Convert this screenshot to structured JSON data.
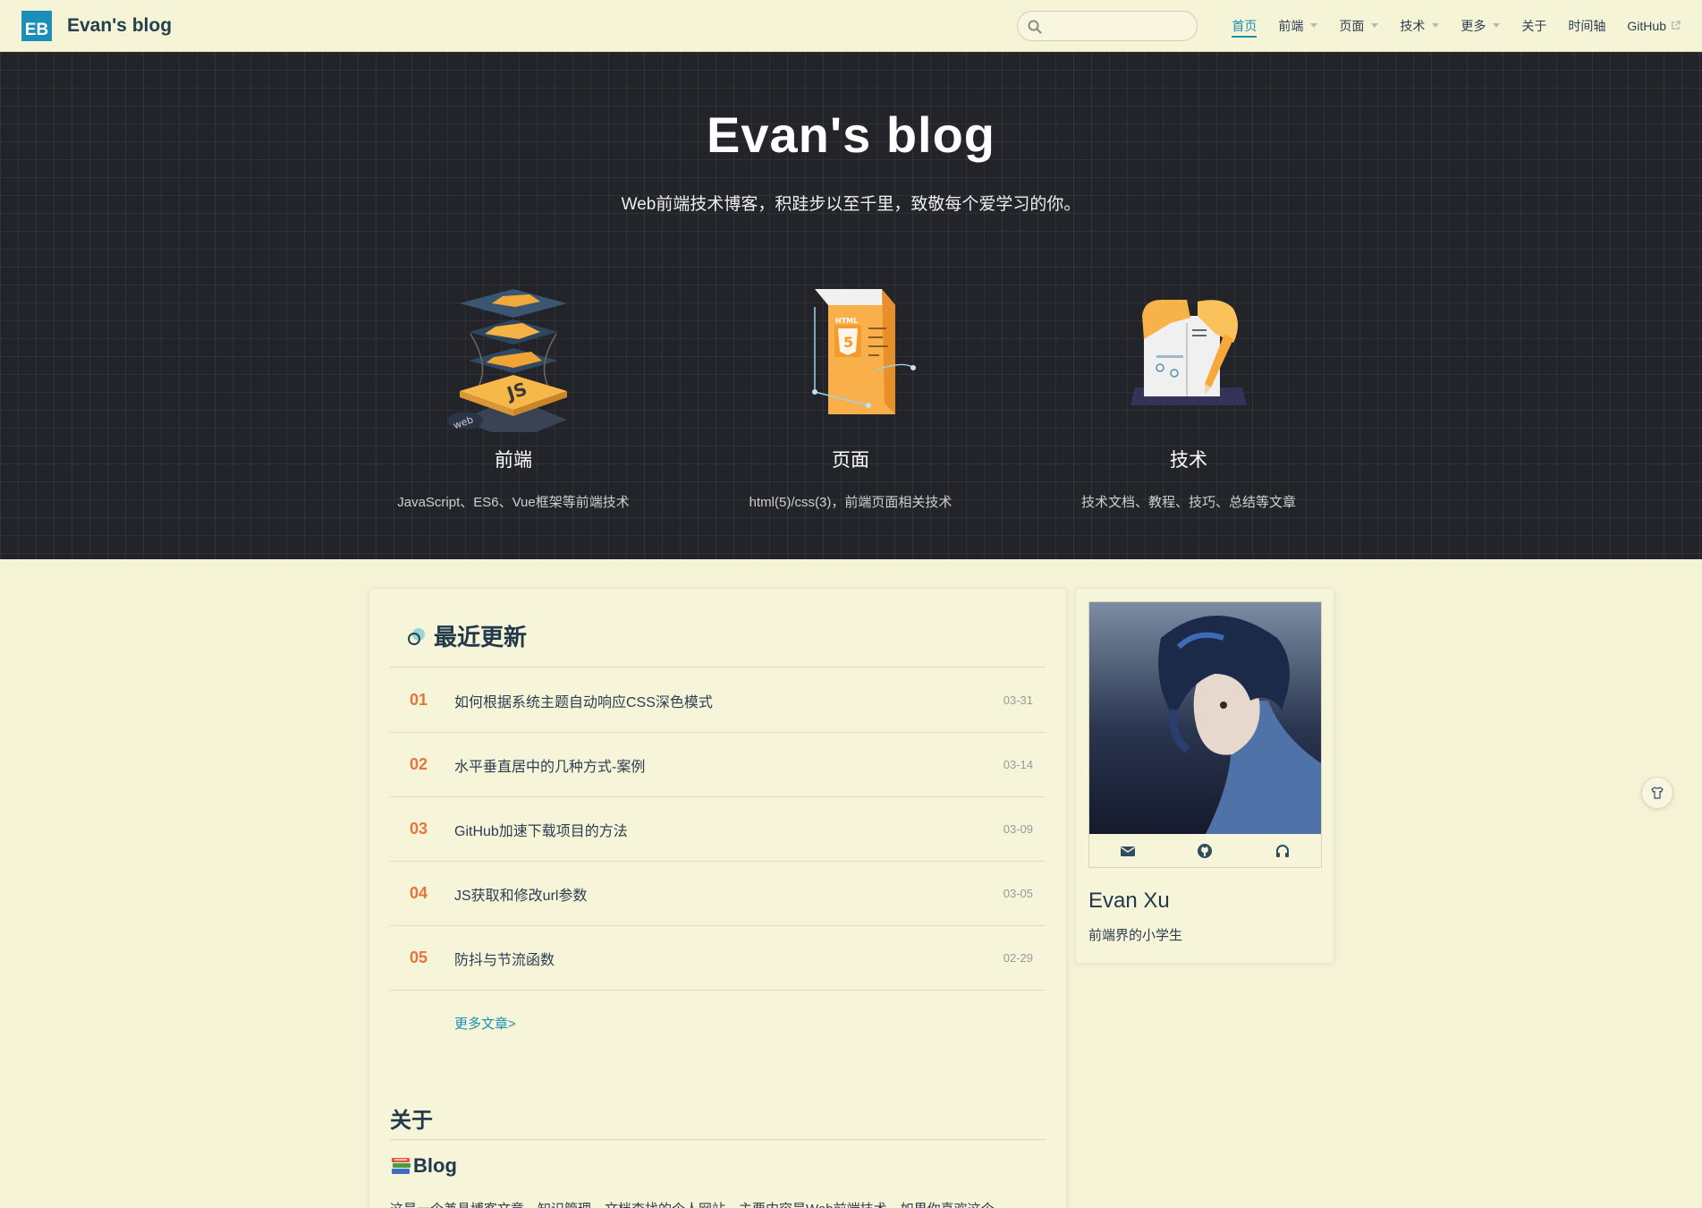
{
  "navbar": {
    "logo_text": "EB",
    "site_name": "Evan's blog",
    "search": {
      "placeholder": "",
      "value": ""
    },
    "items": [
      {
        "label": "首页",
        "active": true,
        "dropdown": false
      },
      {
        "label": "前端",
        "active": false,
        "dropdown": true
      },
      {
        "label": "页面",
        "active": false,
        "dropdown": true
      },
      {
        "label": "技术",
        "active": false,
        "dropdown": true
      },
      {
        "label": "更多",
        "active": false,
        "dropdown": true
      },
      {
        "label": "关于",
        "active": false,
        "dropdown": false
      },
      {
        "label": "时间轴",
        "active": false,
        "dropdown": false
      },
      {
        "label": "GitHub",
        "active": false,
        "dropdown": false,
        "external": true
      }
    ]
  },
  "hero": {
    "title": "Evan's blog",
    "description": "Web前端技术博客，积跬步以至千里，致敬每个爱学习的你。",
    "features": [
      {
        "title": "前端",
        "desc": "JavaScript、ES6、Vue框架等前端技术",
        "icon": "js-layers-icon",
        "badge": "web",
        "badge2": "JS"
      },
      {
        "title": "页面",
        "desc": "html(5)/css(3)，前端页面相关技术",
        "icon": "html5-page-icon",
        "badge": "HTML"
      },
      {
        "title": "技术",
        "desc": "技术文档、教程、技巧、总结等文章",
        "icon": "book-pencil-icon"
      }
    ]
  },
  "recent": {
    "title": "最近更新",
    "posts": [
      {
        "num": "01",
        "title": "如何根据系统主题自动响应CSS深色模式",
        "date": "03-31"
      },
      {
        "num": "02",
        "title": "水平垂直居中的几种方式-案例",
        "date": "03-14"
      },
      {
        "num": "03",
        "title": "GitHub加速下载项目的方法",
        "date": "03-09"
      },
      {
        "num": "04",
        "title": "JS获取和修改url参数",
        "date": "03-05"
      },
      {
        "num": "05",
        "title": "防抖与节流函数",
        "date": "02-29"
      }
    ],
    "more_label": "更多文章>"
  },
  "about": {
    "title": "关于",
    "blog_title": "Blog",
    "text": "这是一个兼具博客文章、知识管理、文档查找的个人网站，主要内容是Web前端技术。如果你喜欢这个"
  },
  "profile": {
    "name": "Evan Xu",
    "bio": "前端界的小学生",
    "contacts": [
      "email-icon",
      "github-icon",
      "headphones-icon"
    ]
  },
  "colors": {
    "accent": "#1b8fb2",
    "post_number": "#e5753a",
    "page_bg": "#f5f3d6",
    "hero_bg": "#23232a"
  }
}
